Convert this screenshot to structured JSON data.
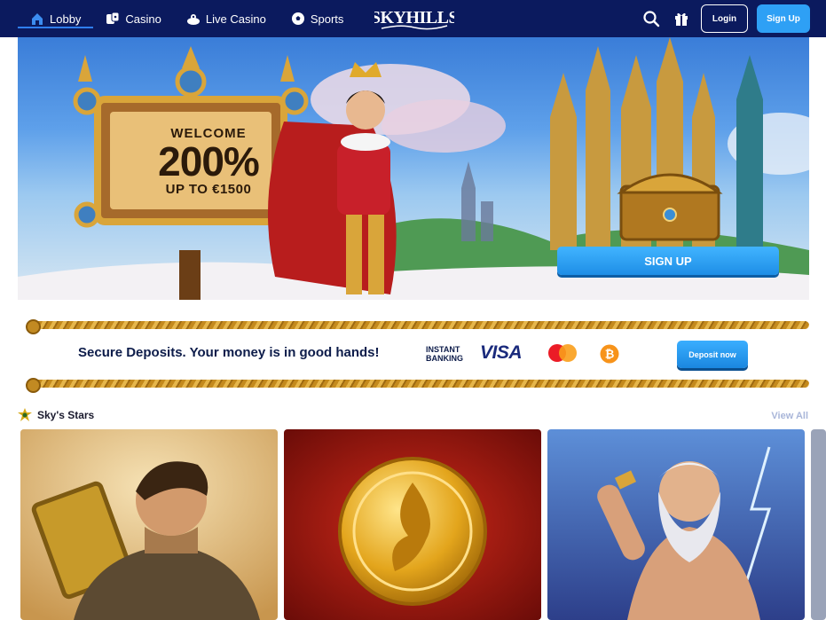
{
  "header": {
    "nav": [
      {
        "label": "Lobby",
        "icon": "home-icon",
        "active": true
      },
      {
        "label": "Casino",
        "icon": "casino-icon",
        "active": false
      },
      {
        "label": "Live Casino",
        "icon": "live-casino-icon",
        "active": false
      },
      {
        "label": "Sports",
        "icon": "soccer-ball-icon",
        "active": false
      }
    ],
    "logo_text": "SKYHILLS",
    "login_label": "Login",
    "signup_label": "Sign Up",
    "icons": [
      "search-icon",
      "gift-icon"
    ]
  },
  "hero": {
    "welcome": "WELCOME",
    "percent": "200%",
    "up_to": "UP TO €1500",
    "cta_label": "SIGN UP"
  },
  "deposits": {
    "text": "Secure Deposits. Your money is in good hands!",
    "instant_banking_line1": "INSTANT",
    "instant_banking_line2": "BANKING",
    "visa": "VISA",
    "button_label": "Deposit now"
  },
  "section": {
    "title": "Sky's Stars",
    "view_all": "View All"
  },
  "colors": {
    "header_bg": "#0b1a5e",
    "accent_blue": "#2ea0f5",
    "gold": "#d9a53a",
    "text_dark": "#0d1c4a"
  }
}
